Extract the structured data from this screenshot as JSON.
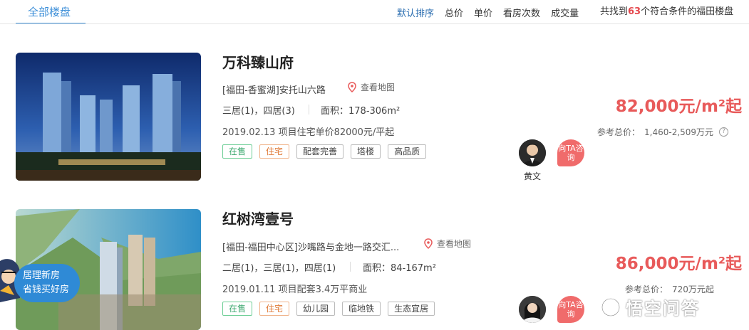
{
  "tabs": {
    "all_label": "全部楼盘"
  },
  "sort": {
    "items": [
      {
        "label": "默认排序",
        "active": true
      },
      {
        "label": "总价",
        "active": false
      },
      {
        "label": "单价",
        "active": false
      },
      {
        "label": "看房次数",
        "active": false
      },
      {
        "label": "成交量",
        "active": false
      }
    ]
  },
  "result": {
    "prefix": "共找到",
    "count": "63",
    "suffix": "个符合条件的福田楼盘"
  },
  "listings": [
    {
      "title": "万科臻山府",
      "address": "[福田-香蜜湖]安托山六路",
      "map_label": "查看地图",
      "rooms": "三居(1)，四居(3)",
      "area": "面积：178-306m²",
      "news": "2019.02.13 项目住宅单价82000元/平起",
      "tags": [
        "在售",
        "住宅",
        "配套完善",
        "塔楼",
        "高品质"
      ],
      "agent_name": "黄文",
      "consult_label": "向TA咨询",
      "price": "82,000元/m²起",
      "total_label": "参考总价：",
      "total_value": "1,460-2,509万元"
    },
    {
      "title": "红树湾壹号",
      "address": "[福田-福田中心区]沙嘴路与金地一路交汇...",
      "map_label": "查看地图",
      "rooms": "二居(1)，三居(1)，四居(1)",
      "area": "面积：84-167m²",
      "news": "2019.01.11 项目配套3.4万平商业",
      "tags": [
        "在售",
        "住宅",
        "幼儿园",
        "临地铁",
        "生态宜居"
      ],
      "agent_name": "",
      "consult_label": "向TA咨询",
      "price": "86,000元/m²起",
      "total_label": "参考总价：",
      "total_value": "720万元起"
    }
  ],
  "promo": {
    "line1": "居理新房",
    "line2": "省钱买好房"
  },
  "watermark": "悟空问答",
  "colors": {
    "accent": "#3b8ed8",
    "price": "#e85a5a",
    "on_sale": "#3aa76d",
    "residential": "#e07b39",
    "consult": "#f06b6b"
  },
  "icons": [
    "map-pin-icon",
    "question-icon",
    "watermark-logo-icon"
  ]
}
